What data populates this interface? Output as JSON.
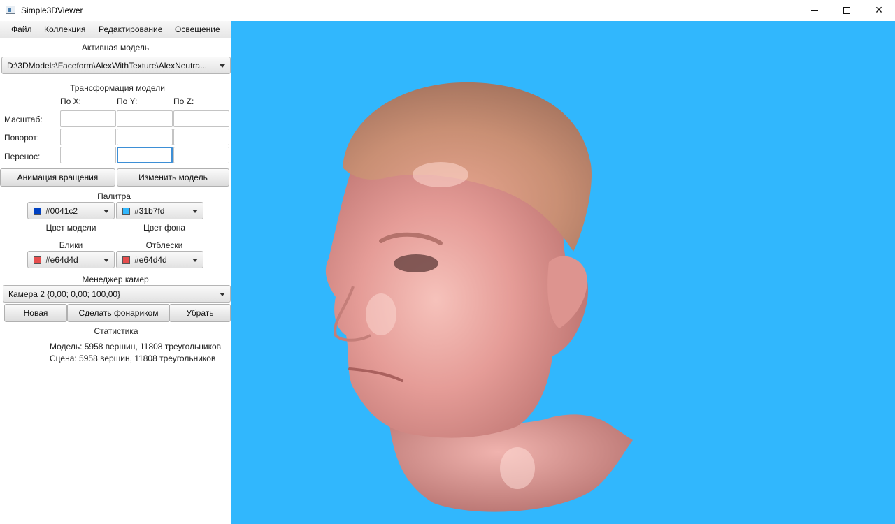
{
  "window": {
    "title": "Simple3DViewer"
  },
  "menu": [
    "Файл",
    "Коллекция",
    "Редактирование",
    "Освещение"
  ],
  "active_model": {
    "heading": "Активная модель",
    "path": "D:\\3DModels\\Faceform\\AlexWithTexture\\AlexNeutra..."
  },
  "transform": {
    "heading": "Трансформация модели",
    "axes": [
      "По X:",
      "По Y:",
      "По Z:"
    ],
    "rows": [
      "Масштаб:",
      "Поворот:",
      "Перенос:"
    ],
    "focused_field": "Перенос:/По Y:"
  },
  "buttons": {
    "rotation_animation": "Анимация вращения",
    "change_model": "Изменить модель"
  },
  "palette": {
    "heading": "Палитра",
    "model_color": {
      "label": "Цвет модели",
      "value": "#0041c2",
      "swatch": "#0041c2"
    },
    "background_color": {
      "label": "Цвет фона",
      "value": "#31b7fd",
      "swatch": "#31b7fd"
    },
    "highlights": {
      "label": "Блики",
      "value": "#e64d4d",
      "swatch": "#e64d4d"
    },
    "reflections": {
      "label": "Отблески",
      "value": "#e64d4d",
      "swatch": "#e64d4d"
    }
  },
  "cameras": {
    "heading": "Менеджер камер",
    "selected": "Камера 2 {0,00;  0,00; 100,00}",
    "new_button": "Новая",
    "flashlight_button": "Сделать фонариком",
    "remove_button": "Убрать"
  },
  "stats": {
    "heading": "Статистика",
    "model": "Модель: 5958 вершин, 11808 треугольников",
    "scene": "Сцена: 5958 вершин, 11808 треугольников"
  },
  "viewport": {
    "background": "#31b7fd",
    "content": "3d-head-model"
  }
}
